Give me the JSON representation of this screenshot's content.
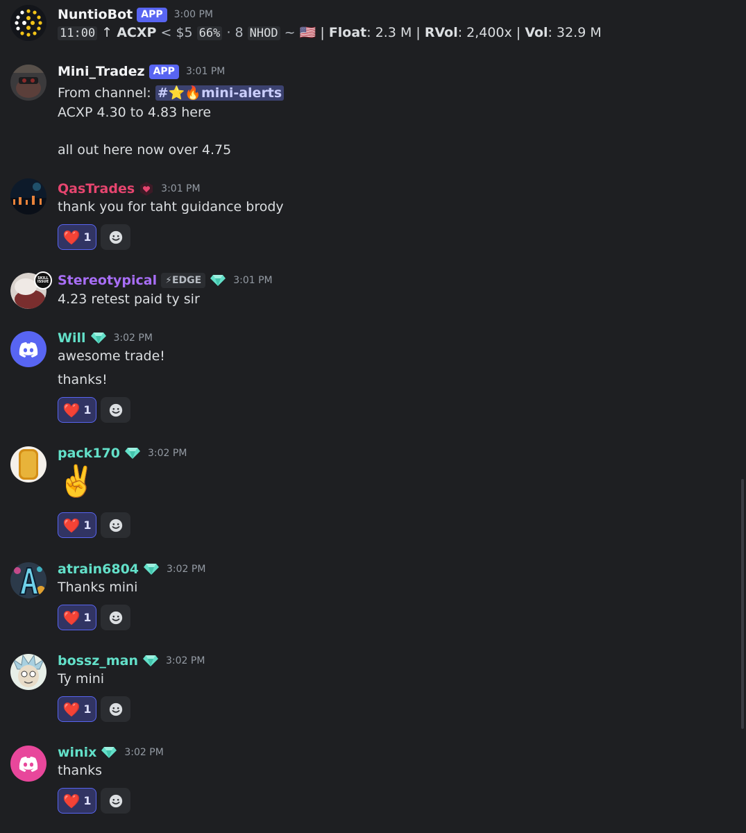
{
  "colors": {
    "background": "#1e1f22",
    "blurple": "#5865f2",
    "teal_name": "#63e0c9",
    "pink_name": "#e6456f",
    "purple_name": "#a86ef6"
  },
  "messages": [
    {
      "author": "NuntioBot",
      "badge": "APP",
      "time": "3:00 PM",
      "alert": {
        "time": "11:00",
        "arrow": "↑",
        "ticker": "ACXP",
        "price": "< $5",
        "pct": "66%",
        "sep": "·",
        "count": "8",
        "nhod": "NHOD",
        "tilde": "~",
        "flag": "🇺🇸",
        "float_label": "Float",
        "float_val": ": 2.3 M",
        "rvol_label": "RVol",
        "rvol_val": ": 2,400x",
        "vol_label": "Vol",
        "vol_val": ": 32.9 M",
        "pipe": "|"
      }
    },
    {
      "author": "Mini_Tradez",
      "badge": "APP",
      "time": "3:01 PM",
      "from": "From channel:",
      "channel": "#⭐🔥mini-alerts",
      "line1": "ACXP 4.30 to 4.83 here",
      "line2": "all out here now over 4.75"
    },
    {
      "author": "QasTrades",
      "time": "3:01 PM",
      "text": "thank you for taht guidance brody",
      "reaction": {
        "emoji": "❤️",
        "count": "1"
      }
    },
    {
      "author": "Stereotypical",
      "tag": "⚡EDGE",
      "time": "3:01 PM",
      "text": "4.23 retest paid ty sir"
    },
    {
      "author": "Will",
      "time": "3:02 PM",
      "text": "awesome trade!",
      "text2": "thanks!",
      "reaction": {
        "emoji": "❤️",
        "count": "1"
      }
    },
    {
      "author": "pack170",
      "time": "3:02 PM",
      "text": "✌️",
      "reaction": {
        "emoji": "❤️",
        "count": "1"
      }
    },
    {
      "author": "atrain6804",
      "time": "3:02 PM",
      "text": "Thanks mini",
      "reaction": {
        "emoji": "❤️",
        "count": "1"
      }
    },
    {
      "author": "bossz_man",
      "time": "3:02 PM",
      "text": "Ty mini",
      "reaction": {
        "emoji": "❤️",
        "count": "1"
      }
    },
    {
      "author": "winix",
      "time": "3:02 PM",
      "text": "thanks",
      "reaction": {
        "emoji": "❤️",
        "count": "1"
      }
    }
  ],
  "icons": {
    "add_reaction": "smile-icon",
    "role": "diamond-icon",
    "discord": "discord-logo-icon"
  }
}
